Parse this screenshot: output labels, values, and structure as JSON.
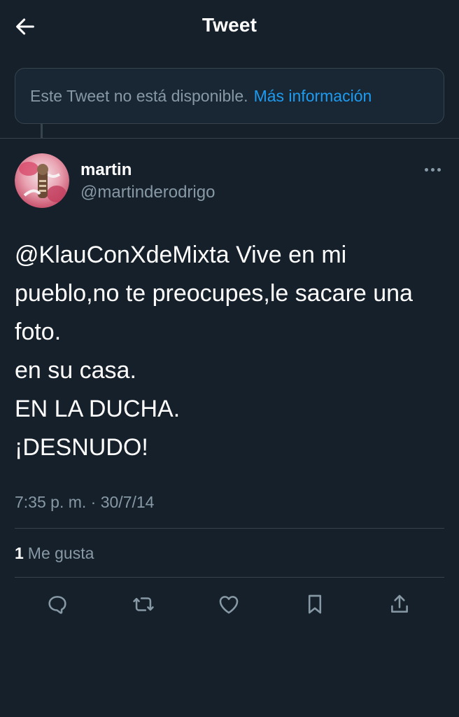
{
  "header": {
    "title": "Tweet"
  },
  "unavailable_notice": {
    "text": "Este Tweet no está disponible.",
    "link": "Más información"
  },
  "tweet": {
    "author_name": "martin",
    "author_handle": "@martinderodrigo",
    "lines": [
      "@KlauConXdeMixta Vive en mi",
      "pueblo,no te preocupes,le sacare una",
      "foto.",
      "en su casa.",
      "EN LA DUCHA.",
      "¡DESNUDO!"
    ],
    "timestamp": "7:35 p. m. · 30/7/14",
    "likes_count": "1",
    "likes_label": "Me gusta"
  },
  "icons": {
    "back": "arrow-left-icon",
    "more": "more-dots-icon",
    "reply": "reply-icon",
    "retweet": "retweet-icon",
    "like": "heart-icon",
    "bookmark": "bookmark-icon",
    "share": "share-icon"
  },
  "colors": {
    "background": "#15202b",
    "text": "#ffffff",
    "secondary_text": "#8899a6",
    "link": "#1d9bf0",
    "border": "#38444d"
  }
}
